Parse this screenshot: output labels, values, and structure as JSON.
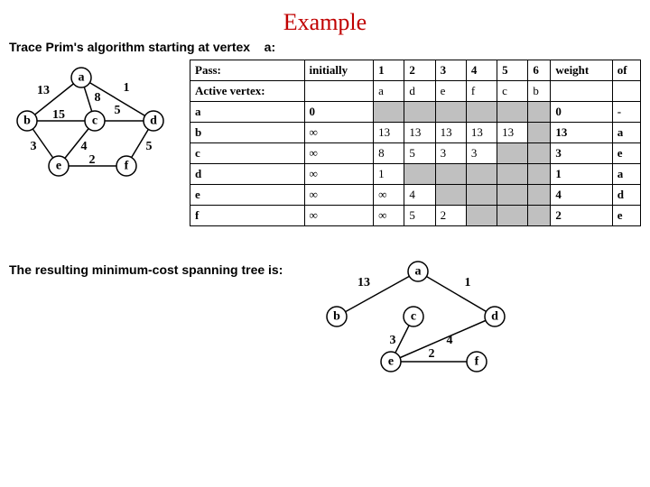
{
  "title": "Example",
  "subtitle_prefix": "Trace Prim's algorithm starting at vertex",
  "subtitle_vertex": "a:",
  "result_text": "The resulting minimum-cost spanning tree is:",
  "graph1": {
    "nodes": [
      "a",
      "b",
      "c",
      "d",
      "e",
      "f"
    ],
    "edges": [
      {
        "from": "a",
        "to": "b",
        "w": "13"
      },
      {
        "from": "a",
        "to": "c",
        "w": "8"
      },
      {
        "from": "a",
        "to": "d",
        "w": "1"
      },
      {
        "from": "b",
        "to": "c",
        "w": "15"
      },
      {
        "from": "c",
        "to": "d",
        "w": "5"
      },
      {
        "from": "b",
        "to": "e",
        "w": "3"
      },
      {
        "from": "c",
        "to": "e",
        "w": "4"
      },
      {
        "from": "e",
        "to": "f",
        "w": "2"
      },
      {
        "from": "d",
        "to": "f",
        "w": "5"
      }
    ]
  },
  "table": {
    "header_pass": "Pass:",
    "header_initially": "initially",
    "passes": [
      "1",
      "2",
      "3",
      "4",
      "5",
      "6"
    ],
    "header_weight": "weight",
    "header_of": "of",
    "active_label": "Active vertex:",
    "active_row": [
      "a",
      "d",
      "e",
      "f",
      "c",
      "b"
    ],
    "rows": [
      {
        "v": "a",
        "init": "0",
        "cells": [
          "",
          "",
          "",
          "",
          "",
          ""
        ],
        "final": "0",
        "of": "-",
        "shaded": [
          0,
          1,
          2,
          3,
          4,
          5
        ]
      },
      {
        "v": "b",
        "init": "∞",
        "cells": [
          "13",
          "13",
          "13",
          "13",
          "13",
          ""
        ],
        "final": "13",
        "of": "a",
        "shaded": [
          5
        ]
      },
      {
        "v": "c",
        "init": "∞",
        "cells": [
          "8",
          "5",
          "3",
          "3",
          "",
          ""
        ],
        "final": "3",
        "of": "e",
        "shaded": [
          4,
          5
        ]
      },
      {
        "v": "d",
        "init": "∞",
        "cells": [
          "1",
          "",
          "",
          "",
          "",
          ""
        ],
        "final": "1",
        "of": "a",
        "shaded": [
          1,
          2,
          3,
          4,
          5
        ]
      },
      {
        "v": "e",
        "init": "∞",
        "cells": [
          "∞",
          "4",
          "",
          "",
          "",
          ""
        ],
        "final": "4",
        "of": "d",
        "shaded": [
          2,
          3,
          4,
          5
        ]
      },
      {
        "v": "f",
        "init": "∞",
        "cells": [
          "∞",
          "5",
          "2",
          "",
          "",
          ""
        ],
        "final": "2",
        "of": "e",
        "shaded": [
          3,
          4,
          5
        ]
      }
    ]
  },
  "graph2": {
    "nodes": [
      "a",
      "b",
      "c",
      "d",
      "e",
      "f"
    ],
    "edges": [
      {
        "from": "a",
        "to": "b",
        "w": "13"
      },
      {
        "from": "a",
        "to": "d",
        "w": "1"
      },
      {
        "from": "c",
        "to": "e",
        "w": "3"
      },
      {
        "from": "d",
        "to": "e",
        "w": "4"
      },
      {
        "from": "e",
        "to": "f",
        "w": "2"
      }
    ]
  }
}
